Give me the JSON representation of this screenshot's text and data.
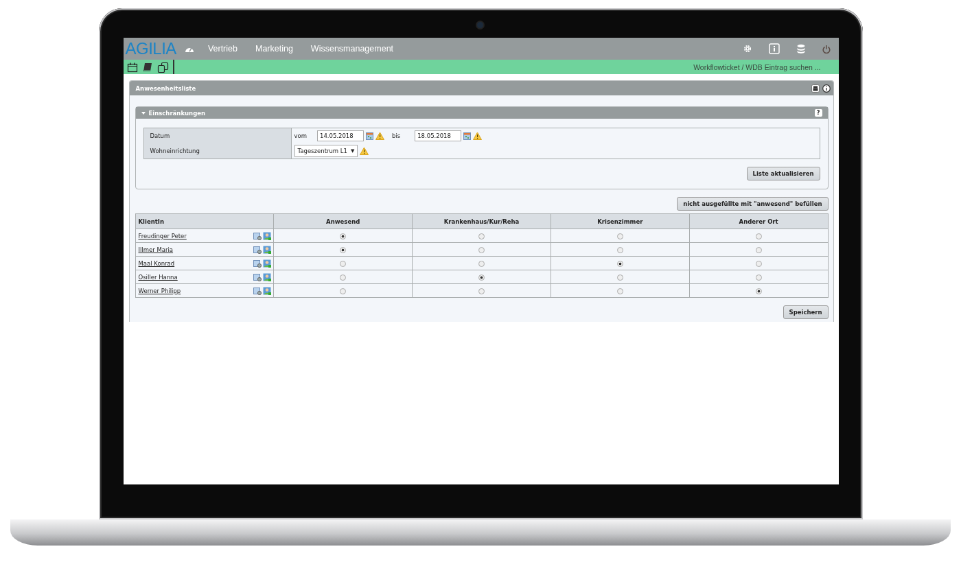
{
  "nav": {
    "logo": "AGILIA",
    "items": [
      {
        "label": "Vertrieb"
      },
      {
        "label": "Marketing"
      },
      {
        "label": "Wissensmanagement"
      }
    ]
  },
  "toolbar": {
    "breadcrumb": "Workflowticket / WDB Eintrag suchen ..."
  },
  "panel": {
    "title": "Anwesenheitsliste",
    "section": {
      "title": "Einschränkungen",
      "expanded": true,
      "help": "?",
      "filters": [
        {
          "kind": "daterange",
          "label": "Datum",
          "from_label": "vom",
          "from": "14.05.2018",
          "to_label": "bis",
          "to": "18.05.2018"
        },
        {
          "kind": "select",
          "label": "Wohneinrichtung",
          "value": "Tageszentrum L1",
          "caret": "▼"
        }
      ],
      "button": "Liste aktualisieren"
    },
    "fill_button": "nicht ausgefüllte mit \"anwesend\" befüllen",
    "table": {
      "columns": [
        "KlientIn",
        "Anwesend",
        "Krankenhaus/Kur/Reha",
        "Krisenzimmer",
        "Anderer Ort"
      ],
      "rows": [
        {
          "name": "Freudinger Peter",
          "options": [
            {
              "selected": true
            },
            {
              "selected": false
            },
            {
              "selected": false
            },
            {
              "selected": false
            }
          ]
        },
        {
          "name": "Illmer Maria",
          "options": [
            {
              "selected": true
            },
            {
              "selected": false
            },
            {
              "selected": false
            },
            {
              "selected": false
            }
          ]
        },
        {
          "name": "Maal Konrad",
          "options": [
            {
              "selected": false
            },
            {
              "selected": false
            },
            {
              "selected": true
            },
            {
              "selected": false
            }
          ]
        },
        {
          "name": "Osiller Hanna",
          "options": [
            {
              "selected": false
            },
            {
              "selected": true
            },
            {
              "selected": false
            },
            {
              "selected": false
            }
          ]
        },
        {
          "name": "Werner Philipp",
          "options": [
            {
              "selected": false
            },
            {
              "selected": false
            },
            {
              "selected": false
            },
            {
              "selected": true
            }
          ]
        }
      ]
    },
    "save_button": "Speichern"
  }
}
